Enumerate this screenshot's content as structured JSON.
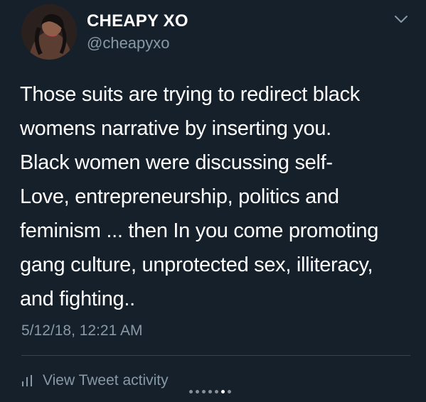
{
  "tweet": {
    "display_name": "CHEAPY XO",
    "handle": "@cheapyxo",
    "text": "Those suits are trying to redirect black\nwomens narrative by inserting you.\nBlack women were discussing self-\nLove, entrepreneurship, politics and\nfeminism ... then In you come promoting\ngang culture, unprotected sex, illiteracy,\nand fighting..",
    "timestamp": "5/12/18, 12:21 AM",
    "activity_label": "View Tweet activity"
  },
  "icons": {
    "avatar": "avatar",
    "menu": "chevron-down-icon",
    "activity": "bar-chart-icon"
  },
  "pager": {
    "count": 7,
    "active_index": 5
  },
  "colors": {
    "background": "#15202b",
    "primary_text": "#ffffff",
    "secondary_text": "#8899a6",
    "divider": "#38444d"
  }
}
